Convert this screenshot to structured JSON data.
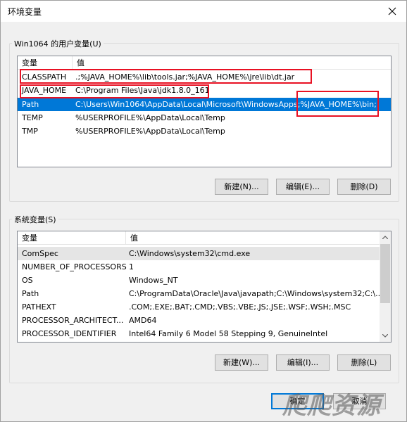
{
  "window": {
    "title": "环境变量"
  },
  "user_vars": {
    "group_label": "Win1064 的用户变量(U)",
    "columns": [
      "变量",
      "值"
    ],
    "rows": [
      {
        "name": "CLASSPATH",
        "value": ".;%JAVA_HOME%\\lib\\tools.jar;%JAVA_HOME%\\jre\\lib\\dt.jar",
        "selected": false
      },
      {
        "name": "JAVA_HOME",
        "value": "C:\\Program Files\\Java\\jdk1.8.0_161",
        "selected": false
      },
      {
        "name": "Path",
        "value": "C:\\Users\\Win1064\\AppData\\Local\\Microsoft\\WindowsApps;%JAVA_HOME%\\bin;",
        "selected": true
      },
      {
        "name": "TEMP",
        "value": "%USERPROFILE%\\AppData\\Local\\Temp",
        "selected": false
      },
      {
        "name": "TMP",
        "value": "%USERPROFILE%\\AppData\\Local\\Temp",
        "selected": false
      }
    ],
    "buttons": {
      "new": "新建(N)...",
      "edit": "编辑(E)...",
      "delete": "删除(D)"
    }
  },
  "system_vars": {
    "group_label": "系统变量(S)",
    "columns": [
      "变量",
      "值"
    ],
    "rows": [
      {
        "name": "ComSpec",
        "value": "C:\\Windows\\system32\\cmd.exe"
      },
      {
        "name": "NUMBER_OF_PROCESSORS",
        "value": "1"
      },
      {
        "name": "OS",
        "value": "Windows_NT"
      },
      {
        "name": "Path",
        "value": "C:\\ProgramData\\Oracle\\Java\\javapath;C:\\Windows\\system32;C:\\..."
      },
      {
        "name": "PATHEXT",
        "value": ".COM;.EXE;.BAT;.CMD;.VBS;.VBE;.JS;.JSE;.WSF;.WSH;.MSC"
      },
      {
        "name": "PROCESSOR_ARCHITECT...",
        "value": "AMD64"
      },
      {
        "name": "PROCESSOR_IDENTIFIER",
        "value": "Intel64 Family 6 Model 58 Stepping 9, GenuineIntel"
      }
    ],
    "buttons": {
      "new": "新建(W)...",
      "edit": "编辑(I)...",
      "delete": "删除(L)"
    }
  },
  "footer": {
    "ok": "确定",
    "cancel": "取消"
  },
  "watermark": "爬爬资源",
  "icons": {
    "close": "close-icon",
    "scroll_up": "chevron-up-icon",
    "scroll_down": "chevron-down-icon"
  },
  "colors": {
    "selection": "#0078d7",
    "highlight_box": "#e81123"
  }
}
